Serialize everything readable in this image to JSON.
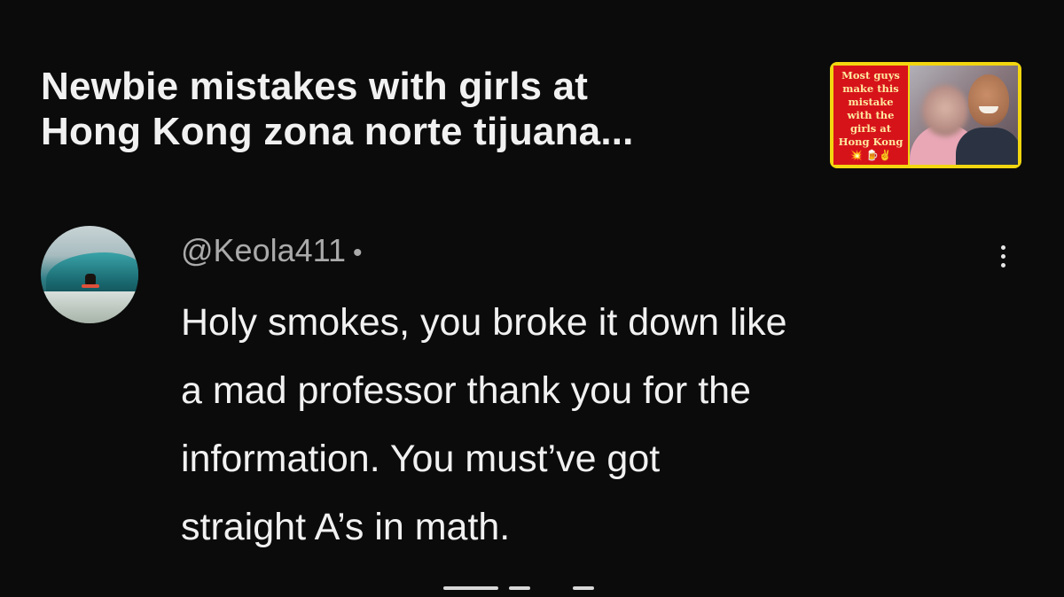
{
  "video": {
    "title": "Newbie mistakes with girls at\nHong Kong zona norte tijuana...",
    "thumbnail_caption": "Most guys make this mistake with the girls at Hong Kong 💥 🍺✌"
  },
  "comment": {
    "author": "@Keola411",
    "separator": "•",
    "text": "Holy smokes, you broke it down like\na mad professor thank you for the\ninformation. You must’ve got\nstraight A’s in math.",
    "menu_icon": "more-vertical-icon"
  },
  "colors": {
    "background": "#0b0b0b",
    "text_primary": "#f1f1f1",
    "text_secondary": "#aaaaaa",
    "thumb_border": "#f2d60f",
    "thumb_caption_bg": "#d7131a"
  }
}
